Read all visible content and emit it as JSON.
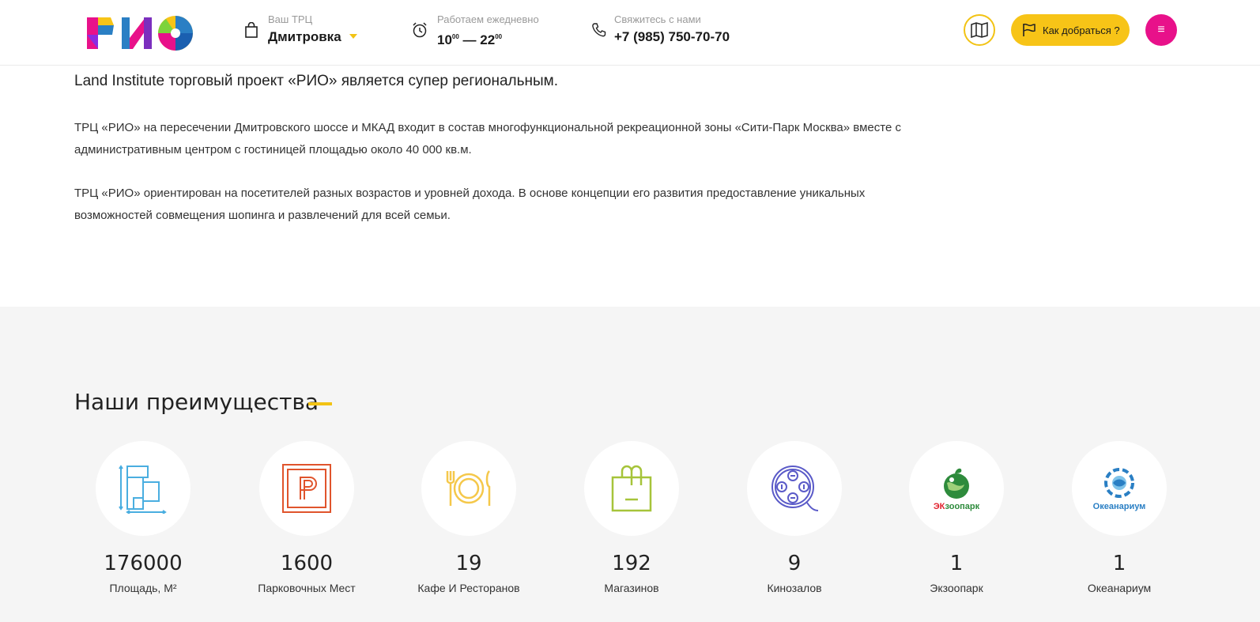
{
  "header": {
    "logo_text": "РИО",
    "mall_label": "Ваш ТРЦ",
    "mall_name": "Дмитровка",
    "hours_label": "Работаем ежедневно",
    "hours_open": "10",
    "hours_open_min": "00",
    "hours_sep": " — ",
    "hours_close": "22",
    "hours_close_min": "00",
    "contact_label": "Свяжитесь с нами",
    "phone": "+7 (985) 750-70-70",
    "route_button": "Как добраться ?",
    "menu_icon": "≡"
  },
  "content": {
    "lead": "Land Institute торговый проект «РИО» является супер региональным.",
    "paragraph1": "ТРЦ «РИО» на пересечении Дмитровского шоссе и МКАД входит в состав многофункциональной рекреационной зоны «Сити-Парк Москва» вместе с административным центром с гостиницей площадью около 40 000 кв.м.",
    "paragraph2": "ТРЦ «РИО» ориентирован на посетителей разных возрастов и уровней дохода. В основе концепции его развития предоставление уникальных возможностей совмещения шопинга и развлечений для всей семьи."
  },
  "advantages": {
    "title": "Наши преимущества",
    "items": [
      {
        "value": "176000",
        "label": "Площадь, М²",
        "icon": "area-plan-icon",
        "color": "#4aaee0"
      },
      {
        "value": "1600",
        "label": "Парковочных Мест",
        "icon": "parking-icon",
        "color": "#e0542c"
      },
      {
        "value": "19",
        "label": "Кафе И Ресторанов",
        "icon": "cutlery-plate-icon",
        "color": "#f5c84a"
      },
      {
        "value": "192",
        "label": "Магазинов",
        "icon": "shopping-bag-icon",
        "color": "#a6c43a"
      },
      {
        "value": "9",
        "label": "Кинозалов",
        "icon": "film-reel-icon",
        "color": "#5a5ac8"
      },
      {
        "value": "1",
        "label": "Экзоопарк",
        "icon": "ekzoopark-logo",
        "logo_text": "ЭКзоопарк",
        "color": "#2e8b3c"
      },
      {
        "value": "1",
        "label": "Океанариум",
        "icon": "oceanarium-logo",
        "logo_text": "Океанариум",
        "color": "#2a7fc4"
      }
    ]
  },
  "colors": {
    "accent_yellow": "#f7c417",
    "accent_pink": "#e8118a",
    "section_bg": "#f5f5f5"
  }
}
